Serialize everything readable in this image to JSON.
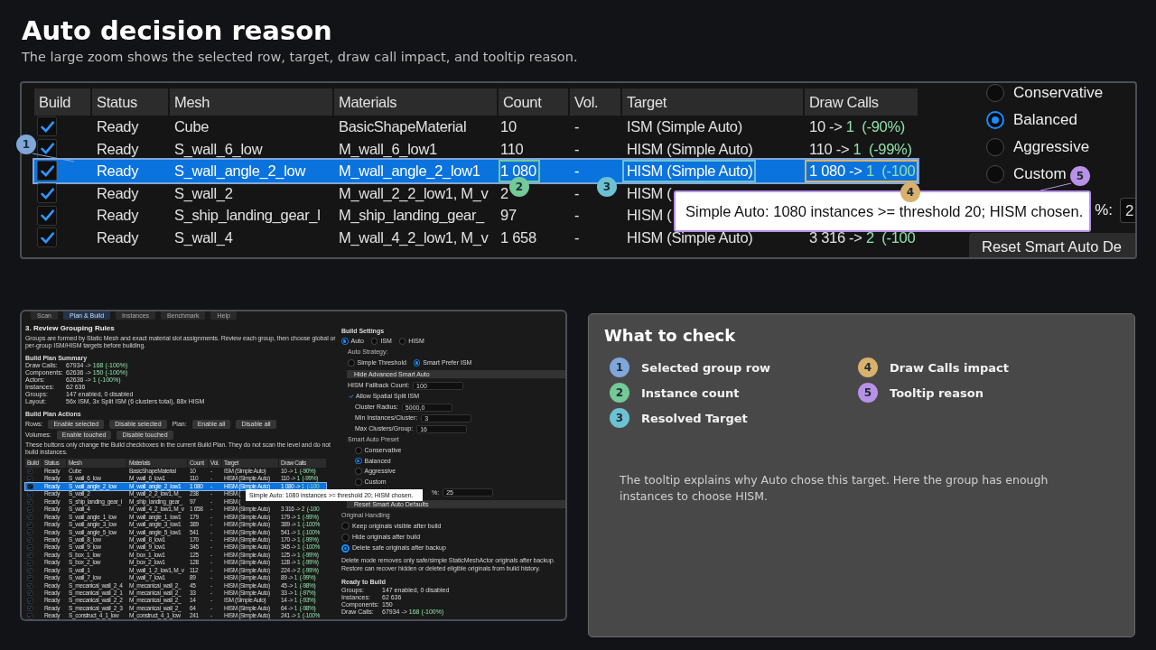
{
  "header": {
    "title": "Auto decision reason",
    "subtitle": "The large zoom shows the selected row, target, draw call impact, and tooltip reason."
  },
  "zoom": {
    "columns": [
      "Build",
      "Status",
      "Mesh",
      "Materials",
      "Count",
      "Vol.",
      "Target",
      "Draw Calls"
    ],
    "rows": [
      {
        "checked": true,
        "selected": false,
        "status": "Ready",
        "mesh": "Cube",
        "materials": "BasicShapeMaterial",
        "count": "10",
        "vol": "-",
        "target": "ISM (Simple Auto)",
        "draw_calls": {
          "before": "10 ->",
          "after": "1",
          "delta": "(-90%)"
        }
      },
      {
        "checked": true,
        "selected": false,
        "status": "Ready",
        "mesh": "S_wall_6_low",
        "materials": "M_wall_6_low1",
        "count": "110",
        "vol": "-",
        "target": "HISM (Simple Auto)",
        "draw_calls": {
          "before": "110 ->",
          "after": "1",
          "delta": "(-99%)"
        }
      },
      {
        "checked": true,
        "selected": true,
        "status": "Ready",
        "mesh": "S_wall_angle_2_low",
        "materials": "M_wall_angle_2_low1",
        "count": "1 080",
        "vol": "-",
        "target": "HISM (Simple Auto)",
        "draw_calls": {
          "before": "1 080 ->",
          "after": "1",
          "delta": "(-100"
        }
      },
      {
        "checked": true,
        "selected": false,
        "status": "Ready",
        "mesh": "S_wall_2",
        "materials": "M_wall_2_2_low1, M_v",
        "count": "2",
        "vol": "-",
        "target": "HISM ("
      },
      {
        "checked": true,
        "selected": false,
        "status": "Ready",
        "mesh": "S_ship_landing_gear_l",
        "materials": "M_ship_landing_gear_",
        "count": "97",
        "vol": "-",
        "target": "HISM ("
      },
      {
        "checked": true,
        "selected": false,
        "status": "Ready",
        "mesh": "S_wall_4",
        "materials": "M_wall_4_2_low1, M_v",
        "count": "1 658",
        "vol": "-",
        "target": "HISM (Simple Auto)",
        "draw_calls": {
          "before": "3 316 ->",
          "after": "2",
          "delta": "(-100"
        }
      }
    ],
    "presets": [
      {
        "label": "Conservative",
        "selected": false
      },
      {
        "label": "Balanced",
        "selected": true
      },
      {
        "label": "Aggressive",
        "selected": false
      },
      {
        "label": "Custom",
        "selected": false
      }
    ],
    "field_label": "%:",
    "field_value": "2",
    "reset_button": "Reset Smart Auto De",
    "tooltip": "Simple Auto: 1080 instances >= threshold 20; HISM chosen.",
    "callouts": [
      {
        "number": "1",
        "color": "#7fa7d9"
      },
      {
        "number": "2",
        "color": "#74c996"
      },
      {
        "number": "3",
        "color": "#6cc2d2"
      },
      {
        "number": "4",
        "color": "#d8b26c"
      },
      {
        "number": "5",
        "color": "#b792e6"
      }
    ]
  },
  "thumbnail": {
    "tabs": [
      {
        "label": "Scan",
        "selected": false
      },
      {
        "label": "Plan & Build",
        "selected": true
      },
      {
        "label": "Instances",
        "selected": false
      },
      {
        "label": "Benchmark",
        "selected": false
      },
      {
        "label": "Help",
        "selected": false
      }
    ],
    "heading": "3. Review Grouping Rules",
    "intro": "Groups are formed by Static Mesh and exact material slot assignments. Review each group, then choose global or per-group ISM/HISM targets before building.",
    "summary_title": "Build Plan Summary",
    "summary": [
      {
        "kind": "change",
        "label": "Draw Calls:",
        "before": "67934 ->",
        "after": "168",
        "delta": "(-100%)"
      },
      {
        "kind": "change",
        "label": "Components:",
        "before": "62636 ->",
        "after": "150",
        "delta": "(-100%)"
      },
      {
        "kind": "change",
        "label": "Actors:",
        "before": "62636 ->",
        "after": "1",
        "delta": "(-100%)"
      },
      {
        "kind": "text",
        "label": "Instances:",
        "value": "62 636"
      },
      {
        "kind": "text",
        "label": "Groups:",
        "value": "147 enabled, 0 disabled"
      },
      {
        "kind": "text",
        "label": "Layout:",
        "value": "56x ISM, 3x Split ISM (6 clusters total), 88x HISM"
      }
    ],
    "actions_title": "Build Plan Actions",
    "action_lines": [
      [
        {
          "label": "Rows:",
          "buttons": [
            "Enable selected",
            "Disable selected"
          ]
        },
        {
          "label": "Plan:",
          "buttons": [
            "Enable all",
            "Disable all"
          ]
        }
      ],
      [
        {
          "label": "Volumes:",
          "buttons": [
            "Enable touched",
            "Disable touched"
          ]
        }
      ]
    ],
    "actions_note": "These buttons only change the Build checkboxes in the current Build Plan. They do not scan the level and do not build instances.",
    "columns": [
      "Build",
      "Status",
      "Mesh",
      "Materials",
      "Count",
      "Vol.",
      "Target",
      "Draw Calls"
    ],
    "rows": [
      {
        "checked": true,
        "selected": false,
        "status": "Ready",
        "mesh": "Cube",
        "materials": "BasicShapeMaterial",
        "count": "10",
        "vol": "-",
        "target": "ISM (Simple Auto)",
        "draw_calls": {
          "before": "10 ->",
          "after": "1",
          "delta": "(-90%)"
        }
      },
      {
        "checked": true,
        "selected": false,
        "status": "Ready",
        "mesh": "S_wall_6_low",
        "materials": "M_wall_6_low1",
        "count": "110",
        "vol": "-",
        "target": "HISM (Simple Auto)",
        "draw_calls": {
          "before": "110 ->",
          "after": "1",
          "delta": "(-99%)"
        }
      },
      {
        "checked": true,
        "selected": true,
        "status": "Ready",
        "mesh": "S_wall_angle_2_low",
        "materials": "M_wall_angle_2_low1",
        "count": "1 080",
        "vol": "-",
        "target": "HISM (Simple Auto)",
        "draw_calls": {
          "before": "1 080 ->",
          "after": "1",
          "delta": "(-100"
        }
      },
      {
        "checked": true,
        "selected": false,
        "status": "Ready",
        "mesh": "S_wall_2",
        "materials": "M_wall_2_2_low1, M_",
        "count": "238",
        "vol": "-",
        "target": "HISM ("
      },
      {
        "checked": true,
        "selected": false,
        "status": "Ready",
        "mesh": "S_ship_landing_gear_l",
        "materials": "M_ship_landing_gear_",
        "count": "97",
        "vol": "-",
        "target": "HISM ("
      },
      {
        "checked": true,
        "selected": false,
        "status": "Ready",
        "mesh": "S_wall_4",
        "materials": "M_wall_4_2_low1, M_v",
        "count": "1 658",
        "vol": "-",
        "target": "HISM (Simple Auto)",
        "draw_calls": {
          "before": "3 316 ->",
          "after": "2",
          "delta": "(-100"
        }
      },
      {
        "checked": true,
        "selected": false,
        "status": "Ready",
        "mesh": "S_wall_angle_1_low",
        "materials": "M_wall_angle_1_low1",
        "count": "179",
        "vol": "-",
        "target": "HISM (Simple Auto)",
        "draw_calls": {
          "before": "179 ->",
          "after": "1",
          "delta": "(-99%)"
        }
      },
      {
        "checked": true,
        "selected": false,
        "status": "Ready",
        "mesh": "S_wall_angle_3_low",
        "materials": "M_wall_angle_3_low1",
        "count": "389",
        "vol": "-",
        "target": "HISM (Simple Auto)",
        "draw_calls": {
          "before": "389 ->",
          "after": "1",
          "delta": "(-100%"
        }
      },
      {
        "checked": true,
        "selected": false,
        "status": "Ready",
        "mesh": "S_wall_angle_5_low",
        "materials": "M_wall_angle_5_low1",
        "count": "541",
        "vol": "-",
        "target": "HISM (Simple Auto)",
        "draw_calls": {
          "before": "541 ->",
          "after": "1",
          "delta": "(-100%"
        }
      },
      {
        "checked": true,
        "selected": false,
        "status": "Ready",
        "mesh": "S_wall_8_low",
        "materials": "M_wall_8_low1",
        "count": "170",
        "vol": "-",
        "target": "HISM (Simple Auto)",
        "draw_calls": {
          "before": "170 ->",
          "after": "1",
          "delta": "(-99%)"
        }
      },
      {
        "checked": true,
        "selected": false,
        "status": "Ready",
        "mesh": "S_wall_9_low",
        "materials": "M_wall_9_low1",
        "count": "345",
        "vol": "-",
        "target": "HISM (Simple Auto)",
        "draw_calls": {
          "before": "345 ->",
          "after": "1",
          "delta": "(-100%"
        }
      },
      {
        "checked": true,
        "selected": false,
        "status": "Ready",
        "mesh": "S_box_1_low",
        "materials": "M_box_1_low1",
        "count": "125",
        "vol": "-",
        "target": "HISM (Simple Auto)",
        "draw_calls": {
          "before": "125 ->",
          "after": "1",
          "delta": "(-99%)"
        }
      },
      {
        "checked": true,
        "selected": false,
        "status": "Ready",
        "mesh": "S_box_2_low",
        "materials": "M_box_2_low1",
        "count": "128",
        "vol": "-",
        "target": "HISM (Simple Auto)",
        "draw_calls": {
          "before": "128 ->",
          "after": "1",
          "delta": "(-99%)"
        }
      },
      {
        "checked": true,
        "selected": false,
        "status": "Ready",
        "mesh": "S_wall_1",
        "materials": "M_wall_1_2_low1, M_v",
        "count": "112",
        "vol": "-",
        "target": "HISM (Simple Auto)",
        "draw_calls": {
          "before": "224 ->",
          "after": "2",
          "delta": "(-99%)"
        }
      },
      {
        "checked": true,
        "selected": false,
        "status": "Ready",
        "mesh": "S_wall_7_low",
        "materials": "M_wall_7_low1",
        "count": "89",
        "vol": "-",
        "target": "HISM (Simple Auto)",
        "draw_calls": {
          "before": "89 ->",
          "after": "1",
          "delta": "(-99%)"
        }
      },
      {
        "checked": true,
        "selected": false,
        "status": "Ready",
        "mesh": "S_mecanical_wall_2_4",
        "materials": "M_mecanical_wall_2_",
        "count": "45",
        "vol": "-",
        "target": "HISM (Simple Auto)",
        "draw_calls": {
          "before": "45 ->",
          "after": "1",
          "delta": "(-98%)"
        }
      },
      {
        "checked": true,
        "selected": false,
        "status": "Ready",
        "mesh": "S_mecanical_wall_2_1",
        "materials": "M_mecanical_wall_2_",
        "count": "33",
        "vol": "-",
        "target": "HISM (Simple Auto)",
        "draw_calls": {
          "before": "33 ->",
          "after": "1",
          "delta": "(-97%)"
        }
      },
      {
        "checked": true,
        "selected": false,
        "status": "Ready",
        "mesh": "S_mecanical_wall_2_2",
        "materials": "M_mecanical_wall_2_",
        "count": "14",
        "vol": "-",
        "target": "ISM (Simple Auto)",
        "draw_calls": {
          "before": "14 ->",
          "after": "1",
          "delta": "(-93%)"
        }
      },
      {
        "checked": true,
        "selected": false,
        "status": "Ready",
        "mesh": "S_mecanical_wall_2_3",
        "materials": "M_mecanical_wall_2_",
        "count": "64",
        "vol": "-",
        "target": "HISM (Simple Auto)",
        "draw_calls": {
          "before": "64 ->",
          "after": "1",
          "delta": "(-98%)"
        }
      },
      {
        "checked": true,
        "selected": false,
        "status": "Ready",
        "mesh": "S_construct_4_1_low",
        "materials": "M_construct_4_1_low",
        "count": "241",
        "vol": "-",
        "target": "HISM (Simple Auto)",
        "draw_calls": {
          "before": "241 ->",
          "after": "1",
          "delta": "(-100%"
        }
      }
    ],
    "tooltip": "Simple Auto: 1080 instances >= threshold 20; HISM chosen.",
    "settings": [
      {
        "kind": "heading",
        "text": "Build Settings"
      },
      {
        "kind": "radios",
        "options": [
          {
            "label": "Auto",
            "selected": true
          },
          {
            "label": "ISM",
            "selected": false
          },
          {
            "label": "HISM",
            "selected": false
          }
        ]
      },
      {
        "kind": "label",
        "text": "Auto Strategy:"
      },
      {
        "kind": "radios",
        "options": [
          {
            "label": "Simple Threshold",
            "selected": false
          },
          {
            "label": "Smart Prefer ISM",
            "selected": true
          }
        ]
      },
      {
        "kind": "bar",
        "text": "Hide Advanced Smart Auto"
      },
      {
        "kind": "field",
        "label": "HISM Fallback Count:",
        "value": "100"
      },
      {
        "kind": "checkbox",
        "label": "Allow Spatial Split ISM",
        "checked": true
      },
      {
        "kind": "field",
        "label": "Cluster Radius:",
        "value": "5000,0"
      },
      {
        "kind": "field",
        "label": "Min Instances/Cluster:",
        "value": "3"
      },
      {
        "kind": "field",
        "label": "Max Clusters/Group:",
        "value": "16"
      },
      {
        "kind": "label",
        "text": "Smart Auto Preset"
      },
      {
        "kind": "stack",
        "options": [
          {
            "label": "Conservative",
            "selected": false
          },
          {
            "label": "Balanced",
            "selected": true
          },
          {
            "label": "Aggressive",
            "selected": false
          },
          {
            "label": "Custom",
            "selected": false
          }
        ]
      },
      {
        "kind": "field",
        "label": "%:",
        "value": "25"
      },
      {
        "kind": "bar",
        "text": "Reset Smart Auto Defaults"
      },
      {
        "kind": "label",
        "text": "Original Handling"
      },
      {
        "kind": "list",
        "options": [
          {
            "label": "Keep originals visible after build",
            "selected": false
          },
          {
            "label": "Hide originals after build",
            "selected": false
          },
          {
            "label": "Delete safe originals after backup",
            "selected": true
          }
        ]
      },
      {
        "kind": "note",
        "text": "Delete mode removes only safe/simple StaticMeshActor originals after backup. Restore can recover hidden or deleted eligible originals from build history."
      },
      {
        "kind": "heading",
        "text": "Ready to Build"
      },
      {
        "kind": "pairs",
        "items": [
          {
            "label": "Groups:",
            "value": "147 enabled, 0 disabled"
          },
          {
            "label": "Instances:",
            "value": "62 636"
          },
          {
            "label": "Components:",
            "value": "150"
          },
          {
            "label": "Draw Calls:",
            "value": "67934 ->",
            "after": "168",
            "delta": "(-100%)"
          }
        ]
      }
    ]
  },
  "legend": {
    "title": "What to check",
    "items": [
      {
        "number": "1",
        "color": "#7fa7d9",
        "label": "Selected group row"
      },
      {
        "number": "2",
        "color": "#74c996",
        "label": "Instance count"
      },
      {
        "number": "3",
        "color": "#6cc2d2",
        "label": "Resolved Target"
      },
      {
        "number": "4",
        "color": "#d8b26c",
        "label": "Draw Calls impact"
      },
      {
        "number": "5",
        "color": "#b792e6",
        "label": "Tooltip reason"
      }
    ],
    "note": "The tooltip explains why Auto chose this target. Here the group has enough instances to choose HISM."
  }
}
